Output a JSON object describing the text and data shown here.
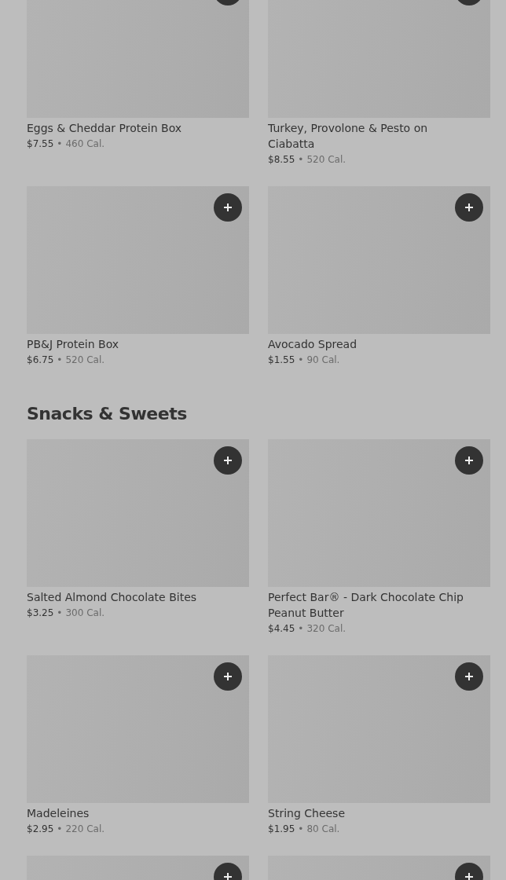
{
  "sections": [
    {
      "items": [
        {
          "kind": "item",
          "name": "Eggs & Cheddar Protein Box",
          "price": "$7.55",
          "separator": "•",
          "calories": "460 Cal."
        },
        {
          "kind": "item",
          "name": "Turkey, Provolone & Pesto on Ciabatta",
          "price": "$8.55",
          "separator": "•",
          "calories": "520 Cal."
        },
        {
          "kind": "item",
          "name": "PB&J Protein Box",
          "price": "$6.75",
          "separator": "•",
          "calories": "520 Cal."
        },
        {
          "kind": "item",
          "name": "Avocado Spread",
          "price": "$1.55",
          "separator": "•",
          "calories": "90 Cal."
        }
      ]
    },
    {
      "title": "Snacks & Sweets",
      "items": [
        {
          "kind": "item",
          "name": "Salted Almond Chocolate Bites",
          "price": "$3.25",
          "separator": "•",
          "calories": "300 Cal."
        },
        {
          "kind": "item",
          "name": "Perfect Bar® - Dark Chocolate Chip Peanut Butter",
          "price": "$4.45",
          "separator": "•",
          "calories": "320 Cal."
        },
        {
          "kind": "item",
          "name": "Madeleines",
          "price": "$2.95",
          "separator": "•",
          "calories": "220 Cal."
        },
        {
          "kind": "item",
          "name": "String Cheese",
          "price": "$1.95",
          "separator": "•",
          "calories": "80 Cal."
        },
        {
          "kind": "partial"
        },
        {
          "kind": "partial"
        }
      ]
    }
  ]
}
